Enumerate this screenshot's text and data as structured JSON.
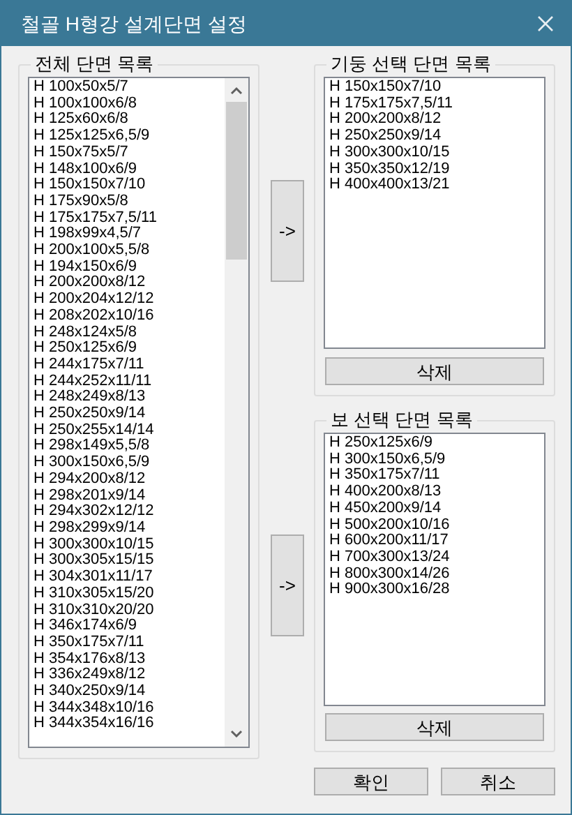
{
  "window": {
    "title": "철골 H형강 설계단면 설정"
  },
  "all_sections": {
    "title": "전체 단면 목록",
    "items": [
      "H 100x50x5/7",
      "H 100x100x6/8",
      "H 125x60x6/8",
      "H 125x125x6,5/9",
      "H 150x75x5/7",
      "H 148x100x6/9",
      "H 150x150x7/10",
      "H 175x90x5/8",
      "H 175x175x7,5/11",
      "H 198x99x4,5/7",
      "H 200x100x5,5/8",
      "H 194x150x6/9",
      "H 200x200x8/12",
      "H 200x204x12/12",
      "H 208x202x10/16",
      "H 248x124x5/8",
      "H 250x125x6/9",
      "H 244x175x7/11",
      "H 244x252x11/11",
      "H 248x249x8/13",
      "H 250x250x9/14",
      "H 250x255x14/14",
      "H 298x149x5,5/8",
      "H 300x150x6,5/9",
      "H 294x200x8/12",
      "H 298x201x9/14",
      "H 294x302x12/12",
      "H 298x299x9/14",
      "H 300x300x10/15",
      "H 300x305x15/15",
      "H 304x301x11/17",
      "H 310x305x15/20",
      "H 310x310x20/20",
      "H 346x174x6/9",
      "H 350x175x7/11",
      "H 354x176x8/13",
      "H 336x249x8/12",
      "H 340x250x9/14",
      "H 344x348x10/16",
      "H 344x354x16/16"
    ]
  },
  "add_buttons": [
    "->",
    "->"
  ],
  "column_sections": {
    "title": "기둥 선택 단면 목록",
    "items": [
      "H 150x150x7/10",
      "H 175x175x7,5/11",
      "H 200x200x8/12",
      "H 250x250x9/14",
      "H 300x300x10/15",
      "H 350x350x12/19",
      "H 400x400x13/21"
    ],
    "delete_button": "삭제"
  },
  "beam_sections": {
    "title": "보 선택 단면 목록",
    "items": [
      "H 250x125x6/9",
      "H 300x150x6,5/9",
      "H 350x175x7/11",
      "H 400x200x8/13",
      "H 450x200x9/14",
      "H 500x200x10/16",
      "H 600x200x11/17",
      "H 700x300x13/24",
      "H 800x300x14/26",
      "H 900x300x16/28"
    ],
    "delete_button": "삭제"
  },
  "buttons": [
    "확인",
    "취소"
  ]
}
